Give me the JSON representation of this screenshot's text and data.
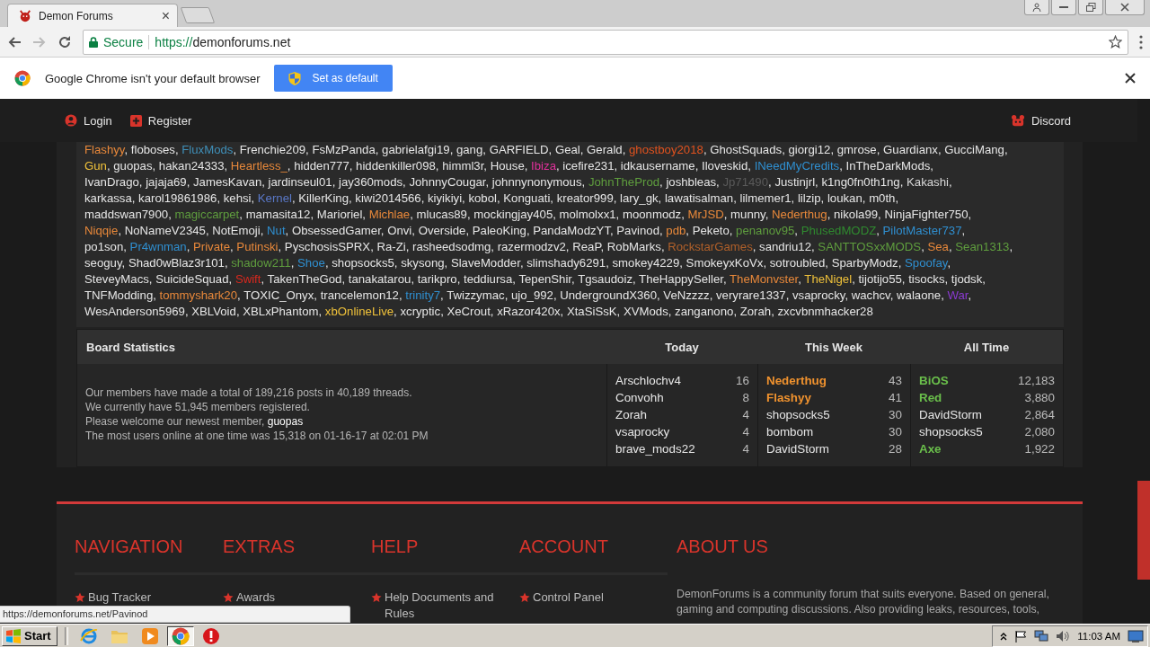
{
  "browser": {
    "tab": {
      "title": "Demon Forums",
      "close": "×"
    },
    "address": {
      "secure": "Secure",
      "scheme": "https://",
      "host": "demonforums.net"
    },
    "infobar": {
      "message": "Google Chrome isn't your default browser",
      "button": "Set as default"
    }
  },
  "site_nav": {
    "left": [
      {
        "label": "Login",
        "kind": "login"
      },
      {
        "label": "Register",
        "kind": "register"
      }
    ],
    "right": [
      {
        "label": "Discord",
        "kind": "discord"
      }
    ]
  },
  "members": {
    "separator": ",",
    "rows": [
      [
        {
          "name": "Flashyy",
          "color": "#e8883a"
        },
        {
          "name": "floboses"
        },
        {
          "name": "FluxMods",
          "color": "#3f8fb8"
        },
        {
          "name": "Frenchie209"
        },
        {
          "name": "FsMzPanda"
        },
        {
          "name": "gabrielafgi19"
        },
        {
          "name": "gang"
        },
        {
          "name": "GARFIELD"
        },
        {
          "name": "Geal"
        },
        {
          "name": "Gerald"
        },
        {
          "name": "ghostboy2018",
          "color": "#e0521e"
        },
        {
          "name": "GhostSquads"
        },
        {
          "name": "giorgi12"
        },
        {
          "name": "gmrose"
        },
        {
          "name": "Guardianx"
        },
        {
          "name": "GucciMang"
        }
      ],
      [
        {
          "name": "Gun",
          "color": "#f0c23a"
        },
        {
          "name": "guopas"
        },
        {
          "name": "hakan24333"
        },
        {
          "name": "Heartless_",
          "color": "#e8883a"
        },
        {
          "name": "hidden777"
        },
        {
          "name": "hiddenkiller098"
        },
        {
          "name": "himml3r"
        },
        {
          "name": "House"
        },
        {
          "name": "Ibiza",
          "color": "#e0309a"
        },
        {
          "name": "icefire231"
        },
        {
          "name": "idkausername"
        },
        {
          "name": "Iloveskid"
        },
        {
          "name": "INeedMyCredits",
          "color": "#2f8fd0"
        },
        {
          "name": "InTheDarkMods"
        }
      ],
      [
        {
          "name": "IvanDrago"
        },
        {
          "name": "jajaja69"
        },
        {
          "name": "JamesKavan"
        },
        {
          "name": "jardinseul01"
        },
        {
          "name": "jay360mods"
        },
        {
          "name": "JohnnyCougar"
        },
        {
          "name": "johnnynonymous"
        },
        {
          "name": "JohnTheProd",
          "color": "#5f9e3e"
        },
        {
          "name": "joshbleas"
        },
        {
          "name": "Jp71490",
          "color": "#5a5a5a"
        },
        {
          "name": "Justinjrl"
        },
        {
          "name": "k1ng0fn0th1ng"
        },
        {
          "name": "Kakashi",
          "color": "#d8d8d8"
        }
      ],
      [
        {
          "name": "karkassa"
        },
        {
          "name": "karol19861986"
        },
        {
          "name": "kehsi"
        },
        {
          "name": "Kernel",
          "color": "#5a78c8"
        },
        {
          "name": "KillerKing"
        },
        {
          "name": "kiwi2014566"
        },
        {
          "name": "kiyikiyi"
        },
        {
          "name": "kobol"
        },
        {
          "name": "Konguati"
        },
        {
          "name": "kreator999"
        },
        {
          "name": "lary_gk"
        },
        {
          "name": "lawatisalman"
        },
        {
          "name": "lilmemer1"
        },
        {
          "name": "lilzip"
        },
        {
          "name": "loukan"
        },
        {
          "name": "m0th"
        }
      ],
      [
        {
          "name": "maddswan7900"
        },
        {
          "name": "magiccarpet",
          "color": "#5f9e3e"
        },
        {
          "name": "mamasita12"
        },
        {
          "name": "Marioriel"
        },
        {
          "name": "Michlae",
          "color": "#e8883a"
        },
        {
          "name": "mlucas89"
        },
        {
          "name": "mockingjay405"
        },
        {
          "name": "molmolxx1"
        },
        {
          "name": "moonmodz"
        },
        {
          "name": "MrJSD",
          "color": "#e8883a"
        },
        {
          "name": "munny"
        },
        {
          "name": "Nederthug",
          "color": "#e8883a"
        },
        {
          "name": "nikola99"
        },
        {
          "name": "NinjaFighter750"
        }
      ],
      [
        {
          "name": "Niqqie",
          "color": "#e8883a"
        },
        {
          "name": "NoNameV2345"
        },
        {
          "name": "NotEmoji"
        },
        {
          "name": "Nut",
          "color": "#2f8fd0"
        },
        {
          "name": "ObsessedGamer"
        },
        {
          "name": "Onvi"
        },
        {
          "name": "Overside"
        },
        {
          "name": "PaleoKing"
        },
        {
          "name": "PandaModzYT"
        },
        {
          "name": "Pavinod"
        },
        {
          "name": "pdb",
          "color": "#e8883a"
        },
        {
          "name": "Peketo"
        },
        {
          "name": "penanov95",
          "color": "#5f9e3e"
        },
        {
          "name": "PhusedMODZ",
          "color": "#2f8a2f"
        },
        {
          "name": "PilotMaster737",
          "color": "#2f8fd0"
        }
      ],
      [
        {
          "name": "po1son"
        },
        {
          "name": "Pr4wnman",
          "color": "#2f8fd0"
        },
        {
          "name": "Private",
          "color": "#e8883a"
        },
        {
          "name": "Putinski",
          "color": "#e8883a"
        },
        {
          "name": "PyschosisSPRX"
        },
        {
          "name": "Ra-Zi"
        },
        {
          "name": "rasheedsodmg"
        },
        {
          "name": "razermodzv2"
        },
        {
          "name": "ReaP"
        },
        {
          "name": "RobMarks"
        },
        {
          "name": "RockstarGames",
          "color": "#b0602a"
        },
        {
          "name": "sandriu12"
        },
        {
          "name": "SANTTOSxxMODS",
          "color": "#5f9e3e"
        },
        {
          "name": "Sea",
          "color": "#e8883a"
        },
        {
          "name": "Sean1313",
          "color": "#5f9e3e"
        }
      ],
      [
        {
          "name": "seoguy"
        },
        {
          "name": "Shad0wBlaz3r101"
        },
        {
          "name": "shadow211",
          "color": "#5f9e3e"
        },
        {
          "name": "Shoe",
          "color": "#2f8fd0"
        },
        {
          "name": "shopsocks5"
        },
        {
          "name": "skysong"
        },
        {
          "name": "SlaveModder"
        },
        {
          "name": "slimshady6291"
        },
        {
          "name": "smokey4229"
        },
        {
          "name": "SmokeyxKoVx"
        },
        {
          "name": "sotroubled"
        },
        {
          "name": "SparbyModz"
        },
        {
          "name": "Spoofay",
          "color": "#2f8fd0"
        }
      ],
      [
        {
          "name": "SteveyMacs"
        },
        {
          "name": "SuicideSquad"
        },
        {
          "name": "Swift",
          "color": "#d9281e"
        },
        {
          "name": "TakenTheGod"
        },
        {
          "name": "tanakatarou"
        },
        {
          "name": "tarikpro"
        },
        {
          "name": "teddiursa"
        },
        {
          "name": "TepenShir"
        },
        {
          "name": "Tgsaudoiz"
        },
        {
          "name": "TheHappySeller"
        },
        {
          "name": "TheMonvster",
          "color": "#e8883a"
        },
        {
          "name": "TheNigel",
          "color": "#f0c23a"
        },
        {
          "name": "tijotijo55"
        },
        {
          "name": "tisocks"
        },
        {
          "name": "tjodsk"
        }
      ],
      [
        {
          "name": "TNFModding"
        },
        {
          "name": "tommyshark20",
          "color": "#e8883a"
        },
        {
          "name": "TOXIC_Onyx"
        },
        {
          "name": "trancelemon12"
        },
        {
          "name": "trinity7",
          "color": "#2f8fd0"
        },
        {
          "name": "Twizzymac"
        },
        {
          "name": "ujo_992"
        },
        {
          "name": "UndergroundX360"
        },
        {
          "name": "VeNzzzz"
        },
        {
          "name": "veryrare1337"
        },
        {
          "name": "vsaprocky"
        },
        {
          "name": "wachcv"
        },
        {
          "name": "walaone"
        },
        {
          "name": "War",
          "color": "#8a3ad0"
        }
      ],
      [
        {
          "name": "WesAnderson5969"
        },
        {
          "name": "XBLVoid"
        },
        {
          "name": "XBLxPhantom"
        },
        {
          "name": "xbOnlineLive",
          "color": "#f0c23a"
        },
        {
          "name": "xcryptic"
        },
        {
          "name": "XeCrout"
        },
        {
          "name": "xRazor420x"
        },
        {
          "name": "XtaSiSsK"
        },
        {
          "name": "XVMods"
        },
        {
          "name": "zanganono"
        },
        {
          "name": "Zorah"
        },
        {
          "name": "zxcvbnmhacker28"
        }
      ]
    ]
  },
  "board_statistics": {
    "title": "Board Statistics",
    "columns": [
      {
        "heading": "Today",
        "entries": [
          {
            "name": "Arschlochv4",
            "count": "16"
          },
          {
            "name": "Convohh",
            "count": "8"
          },
          {
            "name": "Zorah",
            "count": "4"
          },
          {
            "name": "vsaprocky",
            "count": "4"
          },
          {
            "name": "brave_mods22",
            "count": "4"
          }
        ]
      },
      {
        "heading": "This Week",
        "entries": [
          {
            "name": "Nederthug",
            "count": "43",
            "color": "#f0922e"
          },
          {
            "name": "Flashyy",
            "count": "41",
            "color": "#f0922e"
          },
          {
            "name": "shopsocks5",
            "count": "30"
          },
          {
            "name": "bombom",
            "count": "30"
          },
          {
            "name": "DavidStorm",
            "count": "28"
          }
        ]
      },
      {
        "heading": "All Time",
        "entries": [
          {
            "name": "BiOS",
            "count": "12,183",
            "color": "#6abf4b"
          },
          {
            "name": "Red",
            "count": "3,880",
            "color": "#6abf4b"
          },
          {
            "name": "DavidStorm",
            "count": "2,864"
          },
          {
            "name": "shopsocks5",
            "count": "2,080"
          },
          {
            "name": "Axe",
            "count": "1,922",
            "color": "#6abf4b"
          }
        ]
      }
    ],
    "summary": [
      "Our members have made a total of 189,216 posts in 40,189 threads.",
      "We currently have 51,945 members registered."
    ],
    "newest_member": {
      "text": "Please welcome our newest member,",
      "name": "guopas"
    },
    "record": "The most users online at one time was 15,318 on 01-16-17 at 02:01 PM"
  },
  "footer": {
    "columns": [
      {
        "heading": "NAVIGATION",
        "items": [
          "Bug Tracker"
        ]
      },
      {
        "heading": "EXTRAS",
        "items": [
          "Awards"
        ]
      },
      {
        "heading": "HELP",
        "items": [
          "Help Documents and Rules"
        ]
      },
      {
        "heading": "ACCOUNT",
        "items": [
          "Control Panel"
        ]
      }
    ],
    "about": {
      "heading": "ABOUT US",
      "text": "DemonForums is a community forum that suits everyone. Based on general, gaming and computing discussions. Also providing leaks, resources, tools,"
    }
  },
  "status_url": "https://demonforums.net/Pavinod",
  "taskbar": {
    "start": "Start",
    "clock": "11:03 AM",
    "apps": [
      {
        "kind": "ie",
        "selected": false
      },
      {
        "kind": "explorer",
        "selected": false
      },
      {
        "kind": "media",
        "selected": false
      },
      {
        "kind": "chrome",
        "selected": true
      },
      {
        "kind": "security",
        "selected": false
      }
    ]
  }
}
